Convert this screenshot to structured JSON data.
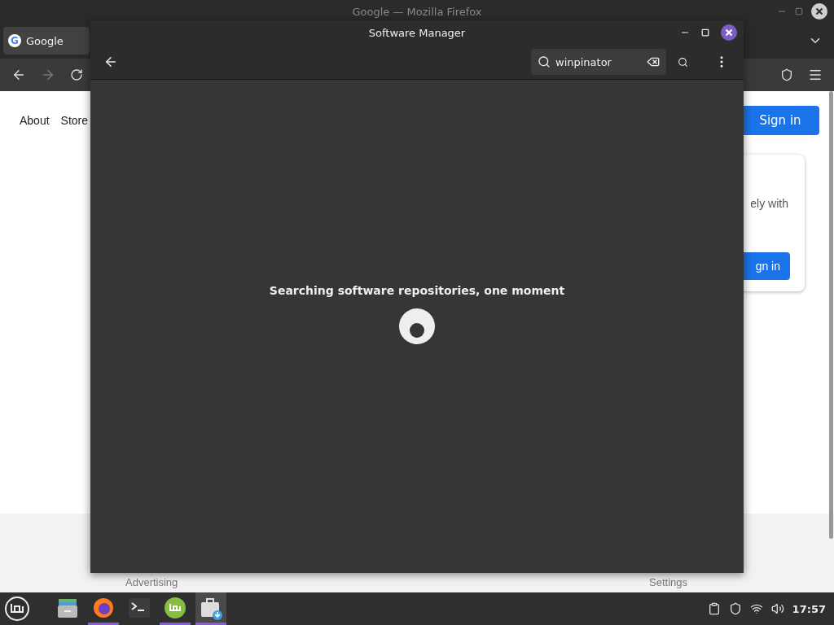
{
  "browser": {
    "title": "Google — Mozilla Firefox",
    "tab": {
      "icon": "G",
      "label": "Google",
      "selected": true
    },
    "nav_links": [
      "About",
      "Store"
    ],
    "sign_in": "Sign in",
    "card": {
      "text": "ely with",
      "button": "gn in"
    },
    "footer": [
      "Advertising",
      "Settings"
    ]
  },
  "software_manager": {
    "title": "Software Manager",
    "search": {
      "value": "winpinator"
    },
    "message": "Searching software repositories, one moment"
  },
  "taskbar": {
    "apps": [
      {
        "kind": "files",
        "running": false,
        "selected": false
      },
      {
        "kind": "firefox",
        "running": true,
        "selected": false
      },
      {
        "kind": "terminal",
        "running": false,
        "selected": false
      },
      {
        "kind": "mint",
        "running": true,
        "selected": false
      },
      {
        "kind": "store",
        "running": true,
        "selected": true
      }
    ],
    "clock": "17:57"
  }
}
